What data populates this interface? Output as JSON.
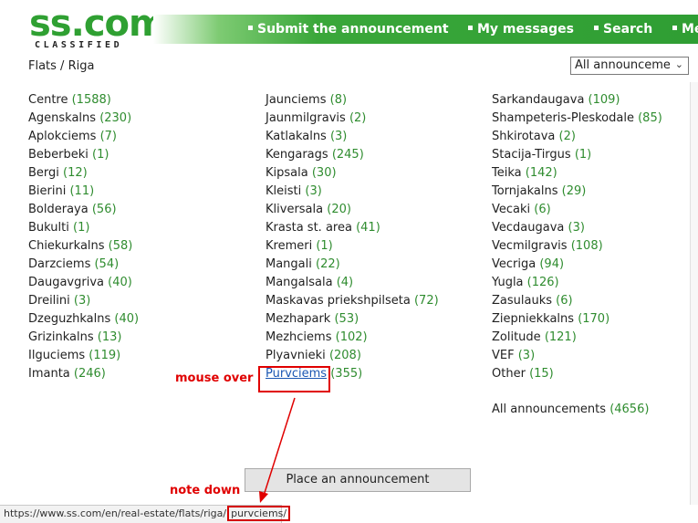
{
  "header": {
    "logo_main": "ss.com",
    "logo_sub": "CLASSIFIED",
    "nav": [
      "Submit the announcement",
      "My messages",
      "Search",
      "Me"
    ]
  },
  "breadcrumb": "Flats / Riga",
  "filter_select": {
    "value": "All announcemen",
    "chevron": "chevron-down-icon"
  },
  "columns": [
    [
      {
        "name": "Centre",
        "count": "(1588)"
      },
      {
        "name": "Agenskalns",
        "count": "(230)"
      },
      {
        "name": "Aplokciems",
        "count": "(7)"
      },
      {
        "name": "Beberbeki",
        "count": "(1)"
      },
      {
        "name": "Bergi",
        "count": "(12)"
      },
      {
        "name": "Bierini",
        "count": "(11)"
      },
      {
        "name": "Bolderaya",
        "count": "(56)"
      },
      {
        "name": "Bukulti",
        "count": "(1)"
      },
      {
        "name": "Chiekurkalns",
        "count": "(58)"
      },
      {
        "name": "Darzciems",
        "count": "(54)"
      },
      {
        "name": "Daugavgriva",
        "count": "(40)"
      },
      {
        "name": "Dreilini",
        "count": "(3)"
      },
      {
        "name": "Dzeguzhkalns",
        "count": "(40)"
      },
      {
        "name": "Grizinkalns",
        "count": "(13)"
      },
      {
        "name": "Ilguciems",
        "count": "(119)"
      },
      {
        "name": "Imanta",
        "count": "(246)"
      }
    ],
    [
      {
        "name": "Jaunciems",
        "count": "(8)"
      },
      {
        "name": "Jaunmilgravis",
        "count": "(2)"
      },
      {
        "name": "Katlakalns",
        "count": "(3)"
      },
      {
        "name": "Kengarags",
        "count": "(245)"
      },
      {
        "name": "Kipsala",
        "count": "(30)"
      },
      {
        "name": "Kleisti",
        "count": "(3)"
      },
      {
        "name": "Kliversala",
        "count": "(20)"
      },
      {
        "name": "Krasta st. area",
        "count": "(41)"
      },
      {
        "name": "Kremeri",
        "count": "(1)"
      },
      {
        "name": "Mangali",
        "count": "(22)"
      },
      {
        "name": "Mangalsala",
        "count": "(4)"
      },
      {
        "name": "Maskavas priekshpilseta",
        "count": "(72)"
      },
      {
        "name": "Mezhapark",
        "count": "(53)"
      },
      {
        "name": "Mezhciems",
        "count": "(102)"
      },
      {
        "name": "Plyavnieki",
        "count": "(208)"
      },
      {
        "name": "Purvciems",
        "count": "(355)",
        "hover": true
      }
    ],
    [
      {
        "name": "Sarkandaugava",
        "count": "(109)"
      },
      {
        "name": "Shampeteris-Pleskodale",
        "count": "(85)"
      },
      {
        "name": "Shkirotava",
        "count": "(2)"
      },
      {
        "name": "Stacija-Tirgus",
        "count": "(1)"
      },
      {
        "name": "Teika",
        "count": "(142)"
      },
      {
        "name": "Tornjakalns",
        "count": "(29)"
      },
      {
        "name": "Vecaki",
        "count": "(6)"
      },
      {
        "name": "Vecdaugava",
        "count": "(3)"
      },
      {
        "name": "Vecmilgravis",
        "count": "(108)"
      },
      {
        "name": "Vecriga",
        "count": "(94)"
      },
      {
        "name": "Yugla",
        "count": "(126)"
      },
      {
        "name": "Zasulauks",
        "count": "(6)"
      },
      {
        "name": "Ziepniekkalns",
        "count": "(170)"
      },
      {
        "name": "Zolitude",
        "count": "(121)"
      },
      {
        "name": "VEF",
        "count": "(3)"
      },
      {
        "name": "Other",
        "count": "(15)"
      }
    ]
  ],
  "all_announcements": {
    "name": "All announcements",
    "count": "(4656)"
  },
  "place_button": "Place an announcement",
  "status_bar": {
    "url_prefix": "https://www.ss.com/en/real-estate/flats/riga/",
    "url_highlight": "purvciems/"
  },
  "annotations": {
    "mouse_over": "mouse over",
    "note_down": "note down",
    "color": "#e00000"
  },
  "colors": {
    "brand_green": "#2fa032",
    "count_green": "#2f8c2f",
    "link_hover": "#1a56b3"
  }
}
